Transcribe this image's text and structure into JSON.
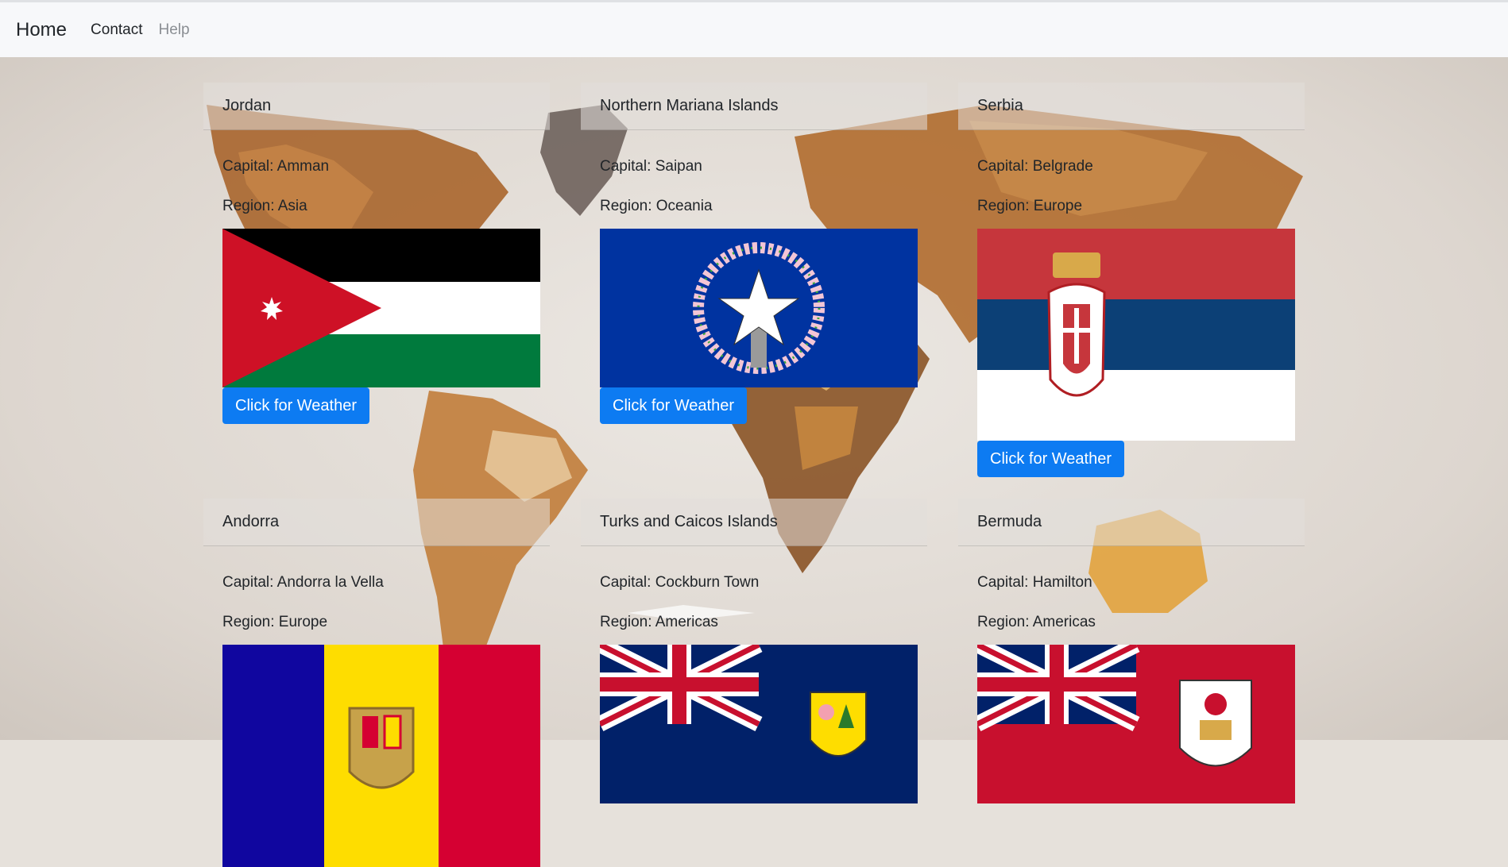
{
  "nav": {
    "brand": "Home",
    "links": [
      {
        "label": "Contact"
      },
      {
        "label": "Help"
      }
    ]
  },
  "capital_prefix": "Capital: ",
  "region_prefix": "Region: ",
  "button_label": "Click for Weather",
  "countries": [
    {
      "name": "Jordan",
      "capital": "Capital: Amman",
      "region": "Region: Asia"
    },
    {
      "name": "Northern Mariana Islands",
      "capital": "Capital: Saipan",
      "region": "Region: Oceania"
    },
    {
      "name": "Serbia",
      "capital": "Capital: Belgrade",
      "region": "Region: Europe"
    },
    {
      "name": "Andorra",
      "capital": "Capital: Andorra la Vella",
      "region": "Region: Europe"
    },
    {
      "name": "Turks and Caicos Islands",
      "capital": "Capital: Cockburn Town",
      "region": "Region: Americas"
    },
    {
      "name": "Bermuda",
      "capital": "Capital: Hamilton",
      "region": "Region: Americas"
    }
  ],
  "buttons": {
    "jordan": "Click for Weather",
    "nmi": "Click for Weather",
    "serbia": "Click for Weather"
  },
  "colors": {
    "button": "#0d7bf2",
    "navbar": "#f7f8fa"
  }
}
